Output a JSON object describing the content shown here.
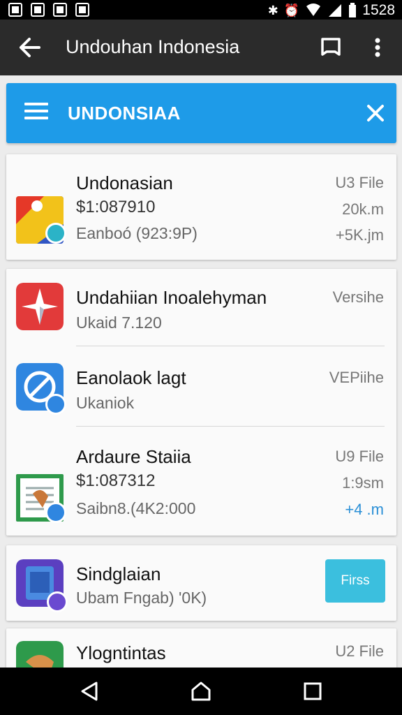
{
  "status_bar": {
    "time": "1528"
  },
  "app_bar": {
    "title": "Undouhan Indonesia"
  },
  "search": {
    "query": "UNDONSIAA"
  },
  "items": [
    {
      "name": "Undonasian",
      "line2": "$1:087910",
      "line3": "Eanboó (923:9P)",
      "right1": "U3 File",
      "right2": "20k.m",
      "right3": "+5K.jm"
    },
    {
      "name": "Undahiian Inoalehyman",
      "line2": "Ukaid 7.120",
      "right1": "Versihe"
    },
    {
      "name": "Eanolaok lagt",
      "line2": "Ukaniok",
      "right1": "VEPiihe"
    },
    {
      "name": "Ardaure Staiia",
      "line2": "$1:087312",
      "line3": "Saibn8.(4K2:000",
      "right1": "U9 File",
      "right2": "1:9sm",
      "right3": "+4 .m"
    },
    {
      "name": "Sindglaian",
      "line2": "Ubam Fngab) '0K)",
      "button": "Firss"
    },
    {
      "name": "Ylogntintas",
      "right1": "U2 File"
    }
  ],
  "colors": {
    "accent": "#1e9be8",
    "appbar": "#2b2b2b",
    "button": "#3bbfde",
    "link": "#2a8fd6"
  }
}
